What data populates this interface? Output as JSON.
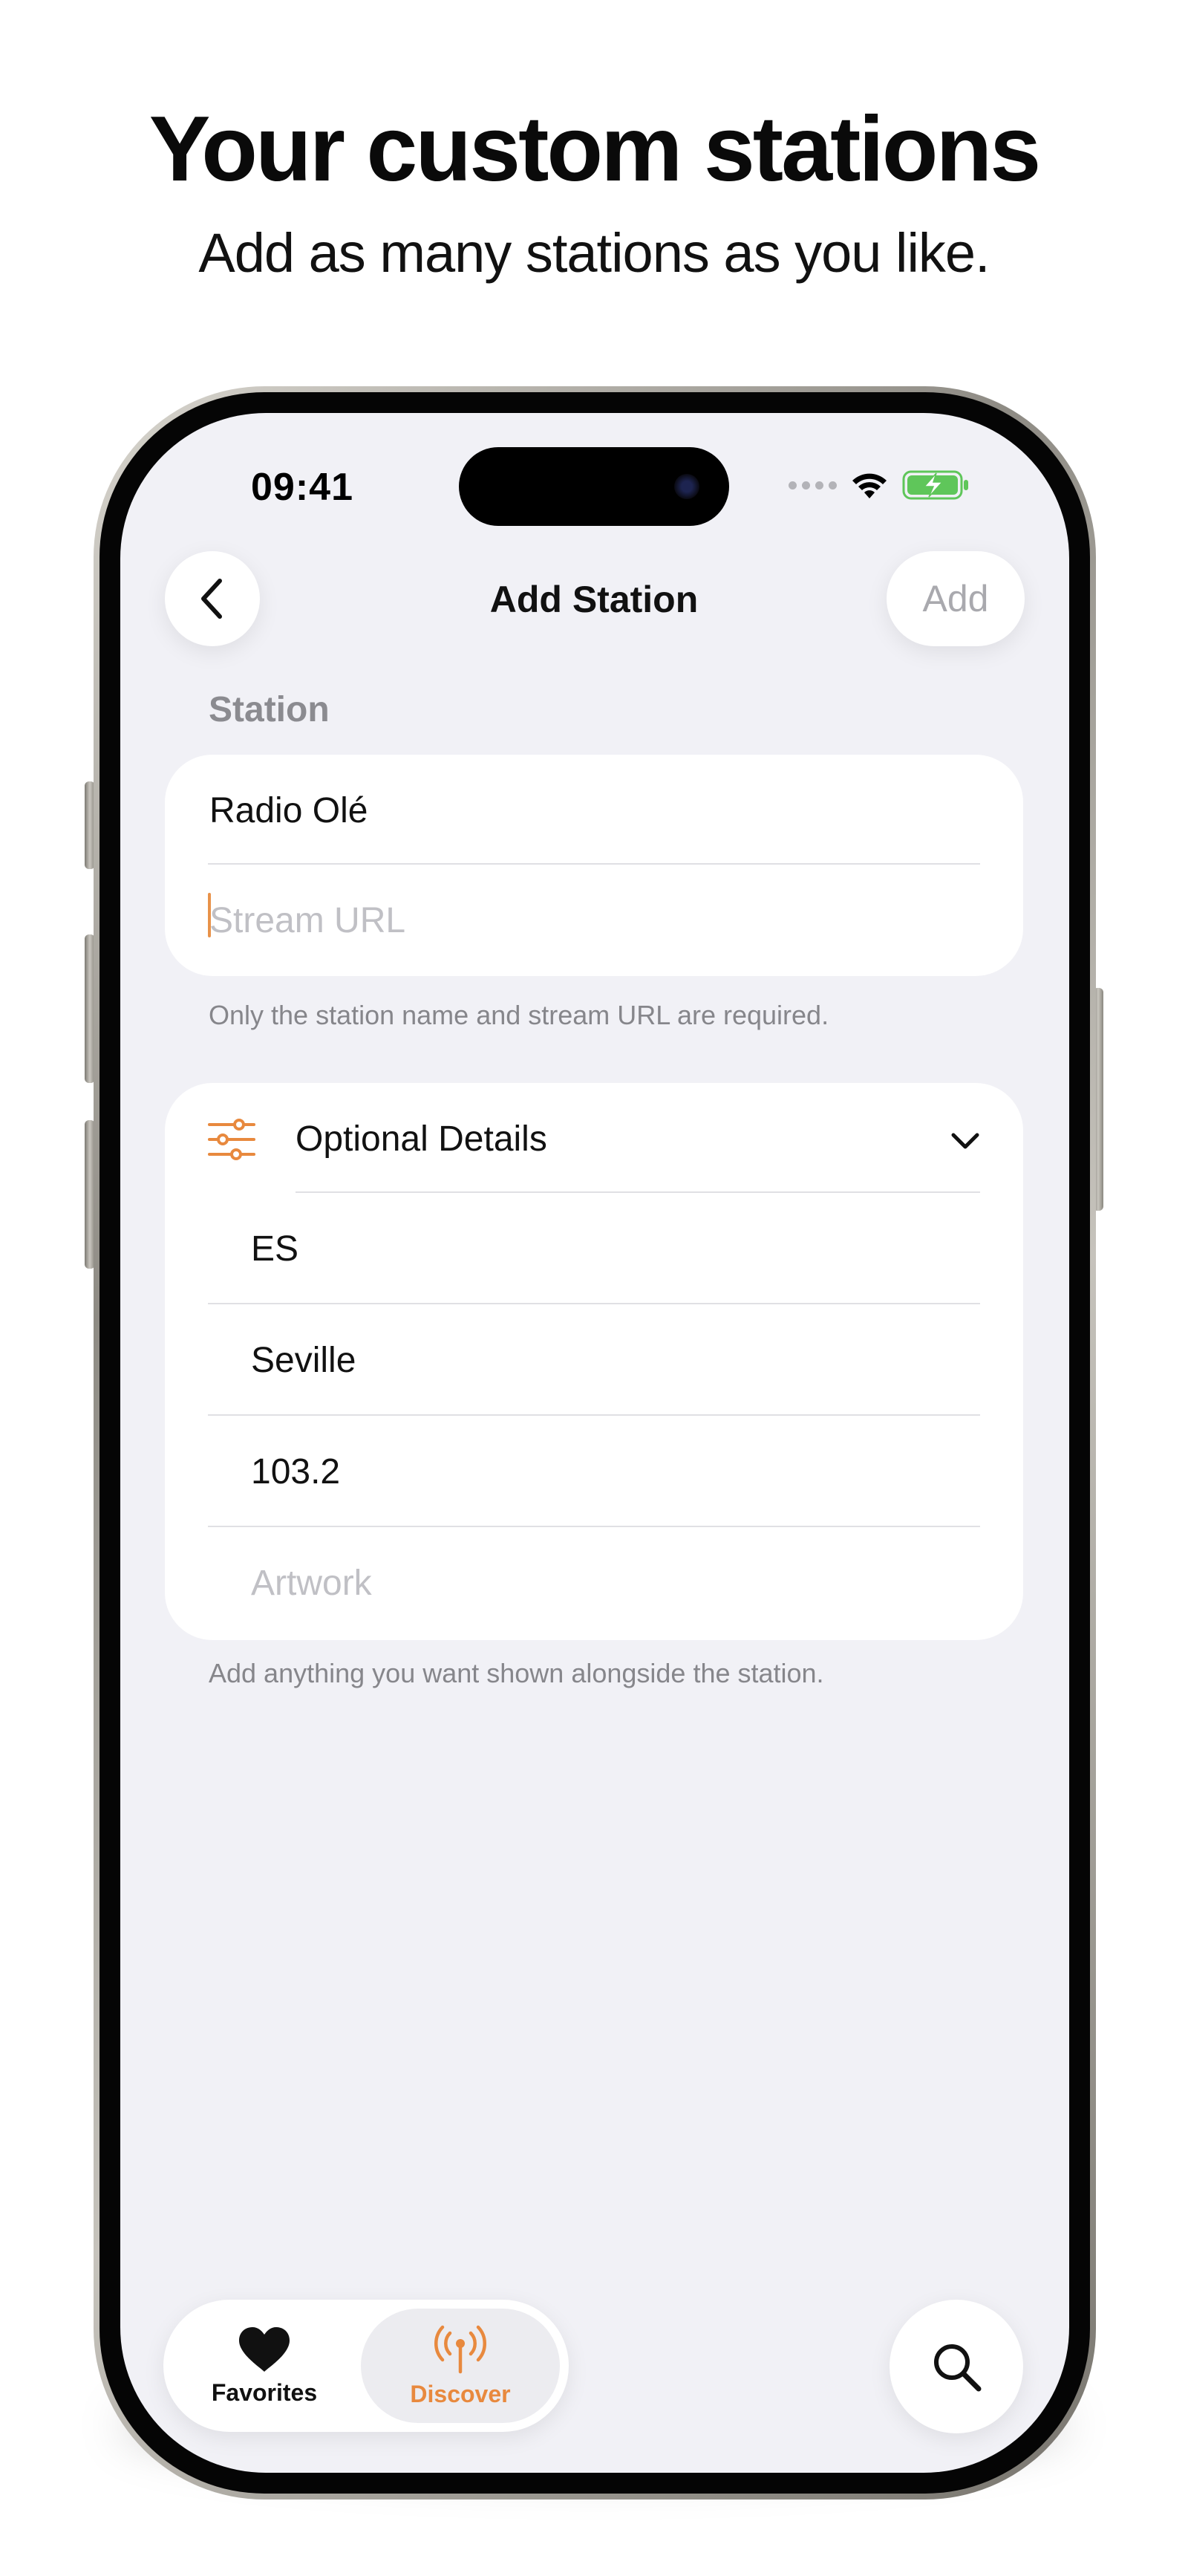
{
  "marketing": {
    "headline": "Your custom stations",
    "subheadline": "Add as many stations as you like."
  },
  "status_bar": {
    "time": "09:41",
    "icons": [
      "cellular-dots-icon",
      "wifi-icon",
      "battery-charging-icon"
    ]
  },
  "nav": {
    "title": "Add Station",
    "add_label": "Add",
    "back_icon": "chevron-left-icon"
  },
  "station_section": {
    "label": "Station",
    "name_value": "Radio Olé",
    "url_placeholder": "Stream URL",
    "footnote": "Only the station name and stream URL are required."
  },
  "optional_section": {
    "header_label": "Optional Details",
    "header_icon": "sliders-icon",
    "fields": [
      {
        "value": "ES",
        "placeholder": ""
      },
      {
        "value": "Seville",
        "placeholder": ""
      },
      {
        "value": "103.2",
        "placeholder": ""
      },
      {
        "value": "",
        "placeholder": "Artwork"
      }
    ],
    "footnote": "Add anything you want shown alongside the station."
  },
  "tab_bar": {
    "tabs": [
      {
        "label": "Favorites",
        "icon": "heart-icon",
        "selected": false
      },
      {
        "label": "Discover",
        "icon": "antenna-icon",
        "selected": true
      }
    ],
    "search_icon": "search-icon"
  },
  "colors": {
    "accent": "#E8893E",
    "background": "#F1F1F6",
    "card": "#FFFFFF",
    "secondary_text": "#8B8B90",
    "battery_green": "#5FC65A"
  }
}
